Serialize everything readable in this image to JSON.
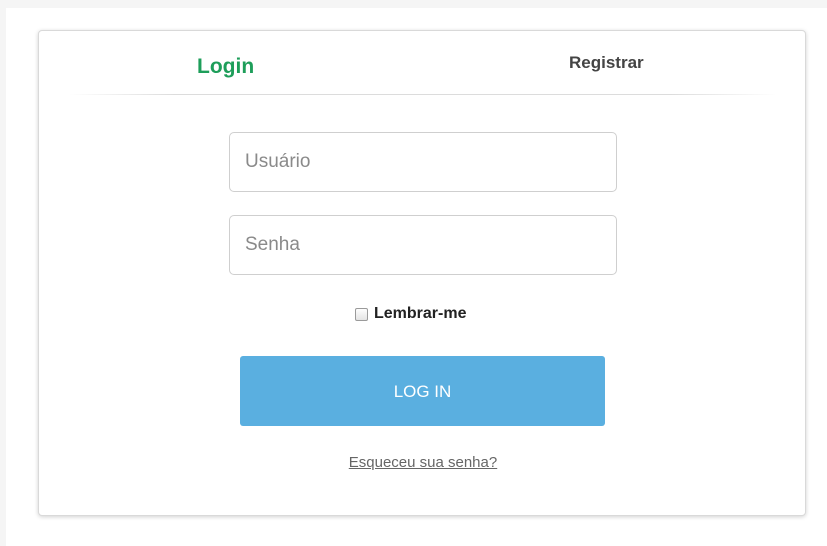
{
  "tabs": {
    "login_label": "Login",
    "register_label": "Registrar"
  },
  "form": {
    "username_placeholder": "Usuário",
    "username_value": "",
    "password_placeholder": "Senha",
    "password_value": "",
    "remember_label": "Lembrar-me",
    "remember_checked": false,
    "submit_label": "LOG IN",
    "forgot_label": "Esqueceu sua senha?"
  },
  "colors": {
    "active_tab": "#1e9e5a",
    "inactive_tab": "#444444",
    "button": "#5aafe0",
    "button_text": "#ffffff",
    "link": "#666666"
  }
}
